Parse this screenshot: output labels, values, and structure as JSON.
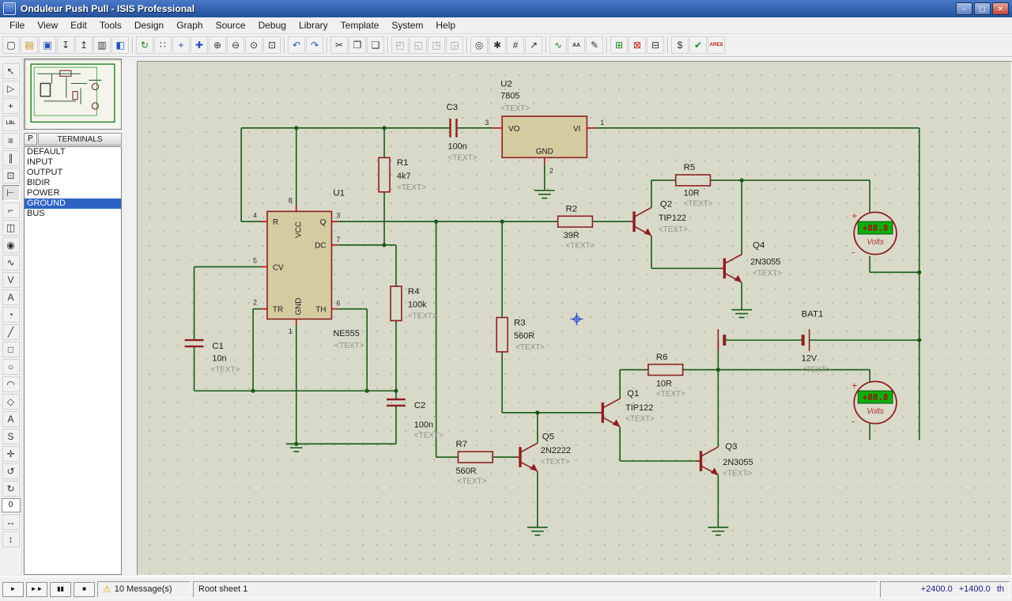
{
  "window": {
    "title": "Onduleur Push Pull - ISIS Professional"
  },
  "icons": {
    "minimize": "–",
    "maximize": "▢",
    "close": "✕",
    "warning": "⚠"
  },
  "menu": {
    "items": [
      "File",
      "View",
      "Edit",
      "Tools",
      "Design",
      "Graph",
      "Source",
      "Debug",
      "Library",
      "Template",
      "System",
      "Help"
    ]
  },
  "toolbar": {
    "items": [
      {
        "name": "new-file",
        "glyph": "▢"
      },
      {
        "name": "open-design",
        "glyph": "▤"
      },
      {
        "name": "save-design",
        "glyph": "▣"
      },
      {
        "name": "import-section",
        "glyph": "↧"
      },
      {
        "name": "export-section",
        "glyph": "↥"
      },
      {
        "name": "print",
        "glyph": "▥"
      },
      {
        "name": "mark-output-area",
        "glyph": "◧"
      },
      {
        "name": "redraw",
        "glyph": "↻"
      },
      {
        "name": "toggle-grid",
        "glyph": "∷"
      },
      {
        "name": "false-origin",
        "glyph": "+"
      },
      {
        "name": "center-at-cursor",
        "glyph": "✚"
      },
      {
        "name": "zoom-in",
        "glyph": "⊕"
      },
      {
        "name": "zoom-out",
        "glyph": "⊖"
      },
      {
        "name": "zoom-all",
        "glyph": "⊙"
      },
      {
        "name": "zoom-area",
        "glyph": "⊡"
      },
      {
        "name": "undo",
        "glyph": "↶"
      },
      {
        "name": "redo",
        "glyph": "↷"
      },
      {
        "name": "cut",
        "glyph": "✂"
      },
      {
        "name": "copy",
        "glyph": "❐"
      },
      {
        "name": "paste",
        "glyph": "❏"
      },
      {
        "name": "block-copy",
        "glyph": "◰"
      },
      {
        "name": "block-move",
        "glyph": "◱"
      },
      {
        "name": "block-rotate",
        "glyph": "◳"
      },
      {
        "name": "block-delete",
        "glyph": "◲"
      },
      {
        "name": "pick-parts",
        "glyph": "◎"
      },
      {
        "name": "make-device",
        "glyph": "✱"
      },
      {
        "name": "packaging-tool",
        "glyph": "#"
      },
      {
        "name": "decompose",
        "glyph": "↗"
      },
      {
        "name": "wire-autorouter",
        "glyph": "∿"
      },
      {
        "name": "search-and-tag",
        "glyph": "AA"
      },
      {
        "name": "property-assignment",
        "glyph": "✎"
      },
      {
        "name": "new-sheet",
        "glyph": "⊞"
      },
      {
        "name": "remove-sheet",
        "glyph": "⊠"
      },
      {
        "name": "goto-sheet",
        "glyph": "⊟"
      },
      {
        "name": "bill-of-materials",
        "glyph": "$"
      },
      {
        "name": "electrical-rule-check",
        "glyph": "✔"
      },
      {
        "name": "netlist-to-ares",
        "glyph": "ARES"
      }
    ]
  },
  "toolcol": {
    "items": [
      {
        "name": "selection-mode",
        "glyph": "↖"
      },
      {
        "name": "component-mode",
        "glyph": "▷"
      },
      {
        "name": "junction-dot-mode",
        "glyph": "+"
      },
      {
        "name": "wire-label-mode",
        "glyph": "LBL"
      },
      {
        "name": "text-script-mode",
        "glyph": "≡"
      },
      {
        "name": "bus-mode",
        "glyph": "∥"
      },
      {
        "name": "subcircuit-mode",
        "glyph": "⊡"
      },
      {
        "name": "terminal-mode",
        "glyph": "⊢"
      },
      {
        "name": "device-pin-mode",
        "glyph": "⌐"
      },
      {
        "name": "graph-mode",
        "glyph": "◫"
      },
      {
        "name": "tape-recorder-mode",
        "glyph": "◉"
      },
      {
        "name": "generator-mode",
        "glyph": "∿"
      },
      {
        "name": "voltage-probe-mode",
        "glyph": "V"
      },
      {
        "name": "current-probe-mode",
        "glyph": "A"
      },
      {
        "name": "virtual-instrument-mode",
        "glyph": "◔"
      },
      {
        "name": "2d-line",
        "glyph": "╱"
      },
      {
        "name": "2d-box",
        "glyph": "□"
      },
      {
        "name": "2d-circle",
        "glyph": "○"
      },
      {
        "name": "2d-arc",
        "glyph": "◠"
      },
      {
        "name": "2d-path",
        "glyph": "◇"
      },
      {
        "name": "2d-text",
        "glyph": "A"
      },
      {
        "name": "2d-symbol",
        "glyph": "S"
      },
      {
        "name": "marker-mode",
        "glyph": "✛"
      },
      {
        "name": "rotate-anticlockwise",
        "glyph": "↺"
      },
      {
        "name": "rotate-clockwise",
        "glyph": "↻"
      },
      {
        "name": "mirror-horizontal",
        "glyph": "↔"
      },
      {
        "name": "mirror-vertical",
        "glyph": "↕"
      }
    ],
    "angle": "0"
  },
  "selector": {
    "pick_button": "P",
    "title": "TERMINALS",
    "items": [
      {
        "label": "DEFAULT",
        "selected": false
      },
      {
        "label": "INPUT",
        "selected": false
      },
      {
        "label": "O​UTPUT",
        "selected": false
      },
      {
        "label": "BIDIR",
        "selected": false
      },
      {
        "label": "POWER",
        "selected": false
      },
      {
        "label": "GROUND",
        "selected": true
      },
      {
        "label": "BUS",
        "selected": false
      }
    ]
  },
  "schematic": {
    "u1": {
      "ref": "U1",
      "value": "NE555",
      "text": "<TEXT>",
      "labels": {
        "r": "R",
        "cv": "CV",
        "tr": "TR",
        "vcc": "VCC",
        "gnd": "GND",
        "q": "Q",
        "dc": "DC",
        "th": "TH"
      },
      "pins": {
        "p1": "1",
        "p2": "2",
        "p3": "3",
        "p4": "4",
        "p5": "5",
        "p6": "6",
        "p7": "7",
        "p8": "8"
      }
    },
    "u2": {
      "ref": "U2",
      "value": "7805",
      "text": "<TEXT>",
      "labels": {
        "vo": "VO",
        "vi": "VI",
        "gnd": "GND"
      },
      "pins": {
        "out": "3",
        "in": "1",
        "gnd": "2"
      }
    },
    "r1": {
      "ref": "R1",
      "value": "4k7",
      "text": "<TEXT>"
    },
    "r2": {
      "ref": "R2",
      "value": "39R",
      "text": "<TEXT>"
    },
    "r3": {
      "ref": "R3",
      "value": "560R",
      "text": "<TEXT>"
    },
    "r4": {
      "ref": "R4",
      "value": "100k",
      "text": "<TEXT>"
    },
    "r5": {
      "ref": "R5",
      "value": "10R",
      "text": "<TEXT>"
    },
    "r6": {
      "ref": "R6",
      "value": "10R",
      "text": "<TEXT>"
    },
    "r7": {
      "ref": "R7",
      "value": "560R",
      "text": "<TEXT>"
    },
    "c1": {
      "ref": "C1",
      "value": "10n",
      "text": "<TEXT>"
    },
    "c2": {
      "ref": "C2",
      "value": "100n",
      "text": "<TEXT>"
    },
    "c3": {
      "ref": "C3",
      "value": "100n",
      "text": "<TEXT>"
    },
    "q1": {
      "ref": "Q1",
      "value": "TIP122",
      "text": "<TEXT>"
    },
    "q2": {
      "ref": "Q2",
      "value": "TIP122",
      "text": "<TEXT>"
    },
    "q3": {
      "ref": "Q3",
      "value": "2N3055",
      "text": "<TEXT>"
    },
    "q4": {
      "ref": "Q4",
      "value": "2N3055",
      "text": "<TEXT>"
    },
    "q5": {
      "ref": "Q5",
      "value": "2N2222",
      "text": "<TEXT>"
    },
    "bat1": {
      "ref": "BAT1",
      "value": "12V",
      "text": "<TEXT>"
    },
    "vm1": {
      "reading": "+88.8",
      "unit": "Volts",
      "plus": "+",
      "minus": "-"
    },
    "vm2": {
      "reading": "+88.8",
      "unit": "Volts",
      "plus": "+",
      "minus": "-"
    }
  },
  "statusbar": {
    "sim": {
      "play": "►",
      "step": "►►",
      "pause": "▮▮",
      "stop": "■"
    },
    "messages": "10 Message(s)",
    "sheet": "Root sheet 1",
    "coord_x": "+2400.0",
    "coord_y": "+1400.0",
    "units": "th"
  }
}
